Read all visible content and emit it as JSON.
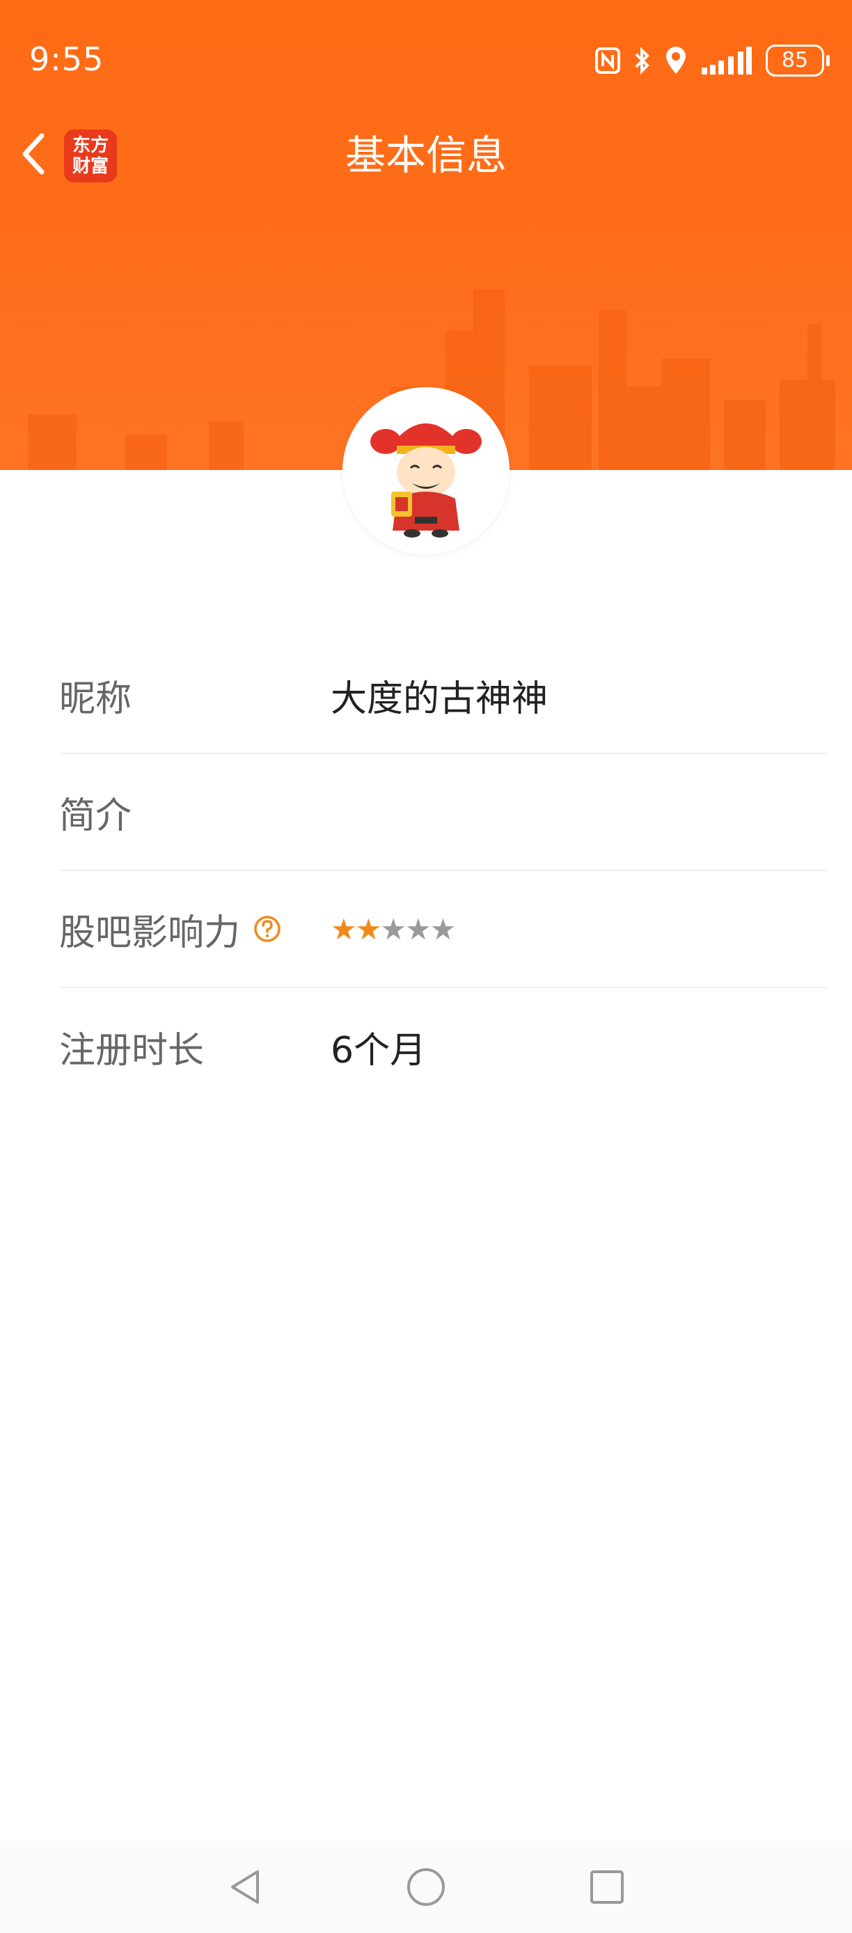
{
  "status_bar": {
    "time": "9:55",
    "battery": "85",
    "icons": [
      "nfc-icon",
      "bluetooth-icon",
      "location-icon",
      "signal-icon",
      "battery-icon"
    ]
  },
  "header": {
    "title": "基本信息",
    "logo_line1": "东方",
    "logo_line2": "财富",
    "background_color": "#ff6a14"
  },
  "profile": {
    "rows": [
      {
        "label": "昵称",
        "value": "大度的古神神"
      },
      {
        "label": "简介",
        "value": ""
      },
      {
        "label": "股吧影响力",
        "stars_filled": 2,
        "stars_total": 5
      },
      {
        "label": "注册时长",
        "value": "6个月"
      }
    ]
  },
  "colors": {
    "accent": "#ff6a14",
    "star_active": "#f08a1c",
    "star_inactive": "#9a9a9a"
  }
}
